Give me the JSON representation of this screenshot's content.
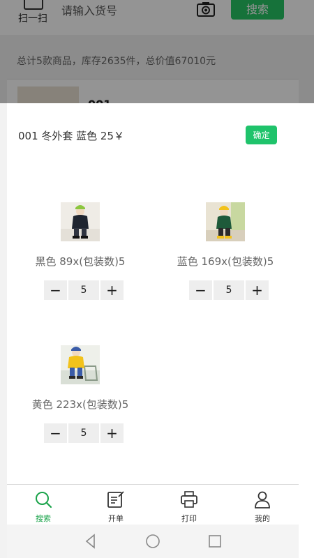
{
  "background_page": {
    "scan_label": "扫一扫",
    "search_placeholder": "请输入货号",
    "search_button": "搜索",
    "summary": "总计5款商品，库存2635件，总价值67010元",
    "row_code_partial": "001"
  },
  "modal": {
    "title": "001 冬外套 蓝色 25￥",
    "confirm_label": "确定",
    "variants": [
      {
        "label": "黑色 89x(包装数)5",
        "quantity": "5",
        "minus": "−",
        "plus": "+"
      },
      {
        "label": "蓝色 169x(包装数)5",
        "quantity": "5",
        "minus": "−",
        "plus": "+"
      },
      {
        "label": "黄色 223x(包装数)5",
        "quantity": "5",
        "minus": "−",
        "plus": "+"
      }
    ]
  },
  "tabbar": {
    "items": [
      {
        "label": "搜索",
        "icon": "search-icon",
        "active": true
      },
      {
        "label": "开单",
        "icon": "edit-note-icon",
        "active": false
      },
      {
        "label": "打印",
        "icon": "printer-icon",
        "active": false
      },
      {
        "label": "我的",
        "icon": "user-icon",
        "active": false
      }
    ]
  },
  "system_nav": [
    "back-icon",
    "home-icon",
    "recents-icon"
  ],
  "colors": {
    "accent_green": "#1fc36b",
    "active_tab": "#1aa34a"
  }
}
